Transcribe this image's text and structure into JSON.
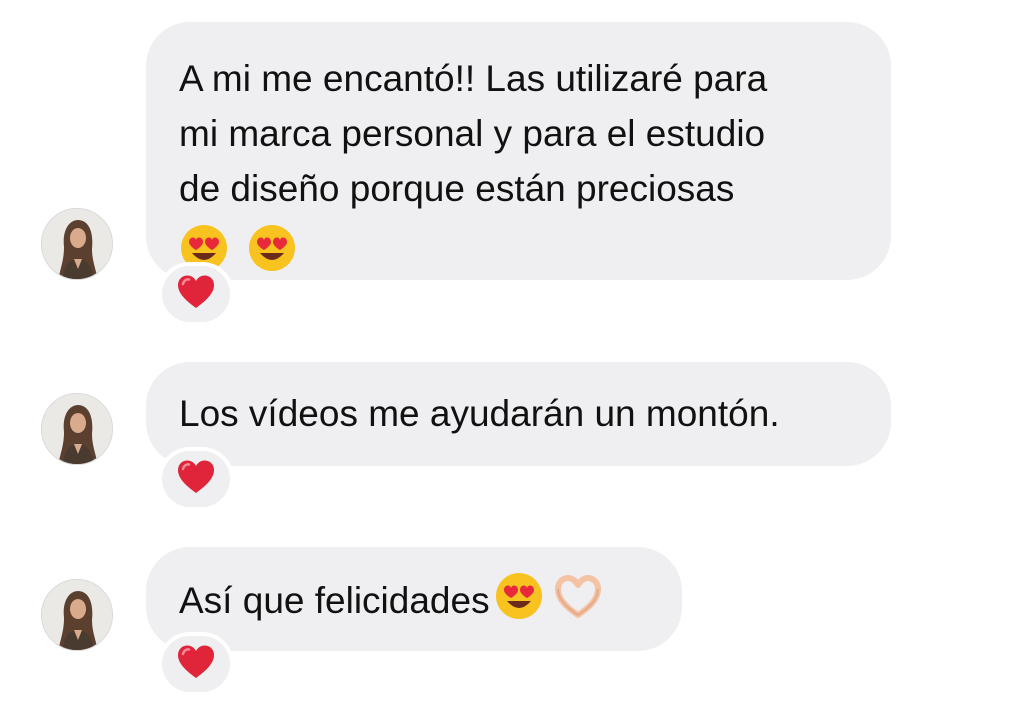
{
  "messages": [
    {
      "lines": [
        "A mi me encantó!! Las utilizaré para",
        "mi marca personal y para el estudio",
        "de diseño porque están preciosas"
      ],
      "trailing_emojis": [
        "heart-eyes-emoji",
        "heart-eyes-emoji"
      ],
      "reaction": "red-heart-icon"
    },
    {
      "lines": [
        "Los vídeos me ayudarán un montón."
      ],
      "trailing_emojis": [],
      "reaction": "red-heart-icon"
    },
    {
      "lines": [
        "Así que felicidades"
      ],
      "trailing_emojis": [
        "heart-eyes-emoji",
        "heart-hands-emoji"
      ],
      "reaction": "red-heart-icon"
    }
  ],
  "colors": {
    "bubble_bg": "#efeff1",
    "text": "#111111",
    "heart": "#e0243a",
    "page_bg": "#ffffff"
  }
}
